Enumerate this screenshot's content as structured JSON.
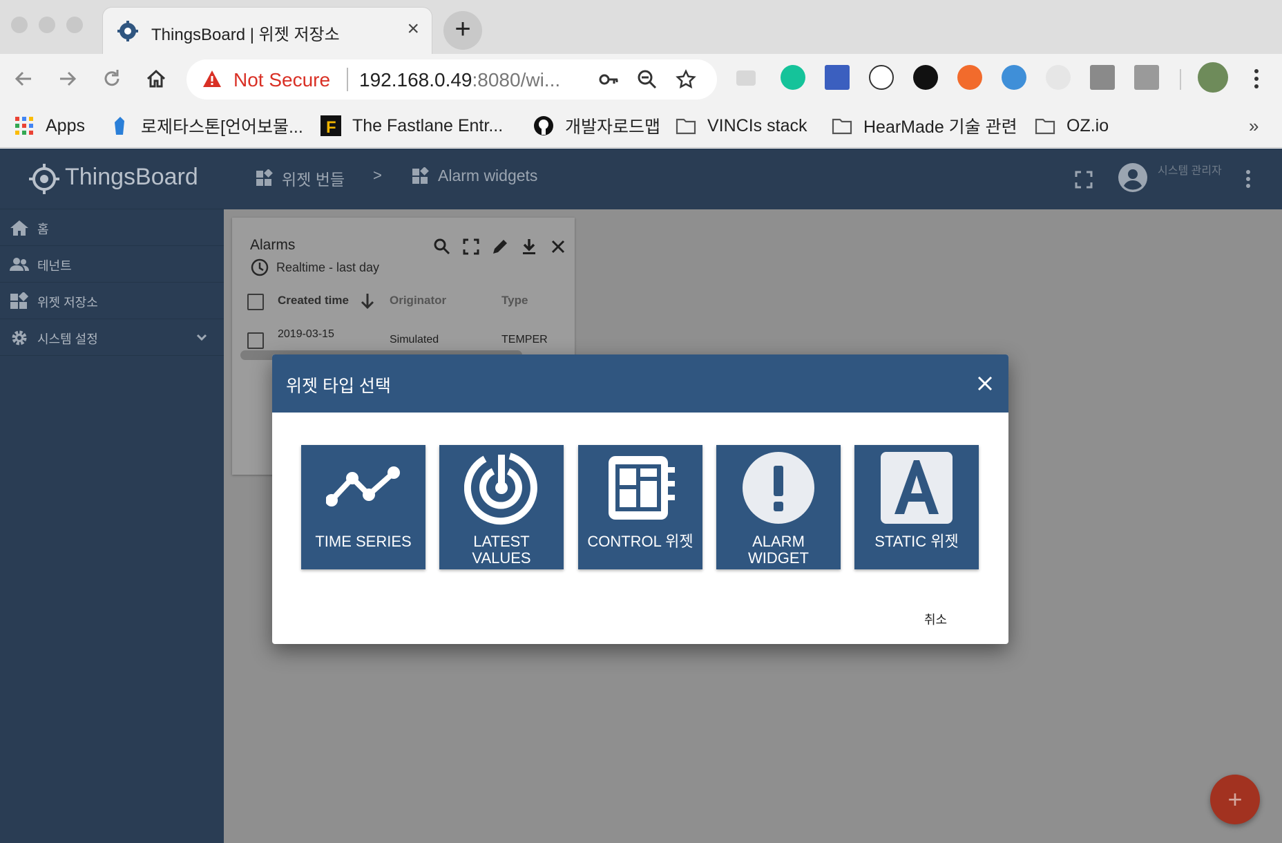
{
  "browser": {
    "tab_title": "ThingsBoard | 위젯 저장소",
    "tab_close": "×",
    "new_tab": "+",
    "security_label": "Not Secure",
    "url_host": "192.168.0.49",
    "url_rest": ":8080/wi...",
    "bookmarks": [
      {
        "label": "Apps",
        "icon": "apps-grid-icon"
      },
      {
        "label": "로제타스톤[언어보물...",
        "icon": "rosetta-stone-icon"
      },
      {
        "label": "The Fastlane Entr...",
        "icon": "fastlane-icon"
      },
      {
        "label": "개발자로드맵",
        "icon": "github-icon"
      },
      {
        "label": "VINCIs stack",
        "icon": "folder-icon"
      },
      {
        "label": "HearMade 기술 관련",
        "icon": "folder-icon"
      },
      {
        "label": "OZ.io",
        "icon": "folder-icon"
      }
    ],
    "bookmarks_overflow": "»"
  },
  "sidebar": {
    "brand": "ThingsBoard",
    "items": [
      {
        "label": "홈",
        "icon": "home-icon"
      },
      {
        "label": "테넌트",
        "icon": "people-icon"
      },
      {
        "label": "위젯 저장소",
        "icon": "widgets-icon"
      },
      {
        "label": "시스템 설정",
        "icon": "gear-icon"
      }
    ]
  },
  "topbar": {
    "breadcrumb": [
      "위젯 번들",
      "Alarm widgets"
    ],
    "breadcrumb_separator": ">",
    "user_role": "시스템 관리자"
  },
  "alarm_card": {
    "title": "Alarms",
    "timewindow": "Realtime - last day",
    "columns": [
      "Created time",
      "Originator",
      "Type"
    ],
    "first_row": {
      "created_time": "2019-03-15",
      "originator": "Simulated",
      "type": "TEMPER"
    }
  },
  "dialog": {
    "title": "위젯 타입 선택",
    "tiles": [
      {
        "label": "TIME SERIES",
        "icon": "time-series-icon"
      },
      {
        "label": "LATEST VALUES",
        "icon": "latest-values-icon"
      },
      {
        "label": "CONTROL 위젯",
        "icon": "control-widget-icon"
      },
      {
        "label": "ALARM WIDGET",
        "icon": "alarm-widget-icon"
      },
      {
        "label": "STATIC 위젯",
        "icon": "static-widget-icon"
      }
    ],
    "cancel": "취소"
  },
  "fab": {
    "label": "+"
  },
  "colors": {
    "primary": "#305680",
    "sidebar_bg": "#2a3d54",
    "fab": "#a23220",
    "warning": "#d93025"
  }
}
